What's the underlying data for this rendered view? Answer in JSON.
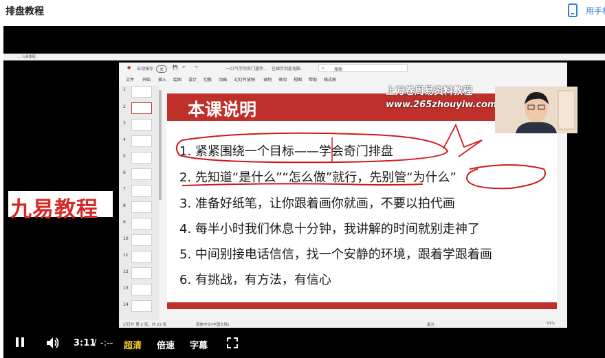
{
  "header": {
    "title": "排盘教程",
    "phone_link": "用手机"
  },
  "window_tab": {
    "text": "… 九易教程"
  },
  "ppt": {
    "autosave": "自动保存",
    "autosave_state": "关",
    "doc_name": "一口气学完奇门遁甲…",
    "save_state": "已保存到此电脑",
    "search_placeholder": "搜索",
    "menu": [
      "文件",
      "开始",
      "插入",
      "绘图",
      "设计",
      "切换",
      "动画",
      "幻灯片放映",
      "录制",
      "审阅",
      "视图",
      "帮助",
      "格式刷"
    ],
    "status_left": "幻灯片 第 2 张，共 23 张",
    "status_lang": "简体中文(中国大陆)",
    "status_notes": "备注",
    "zoom": "91%",
    "thumb_numbers": [
      "1",
      "2",
      "3",
      "4",
      "5",
      "6",
      "7",
      "8",
      "9",
      "10",
      "11",
      "12",
      "13",
      "14"
    ]
  },
  "slide": {
    "title": "本课说明",
    "lines": [
      "1. 紧紧围绕一个目标——学会奇门排盘",
      "2. 先知道“是什么”“怎么做”就行，先别管“为什么”",
      "3. 准备好纸笔，让你跟着画你就画，不要以拍代画",
      "4. 每半小时我们休息十分钟，我讲解的时间就别走神了",
      "5. 中间别接电话信信，找一个安静的环境，跟着学跟着画",
      "6. 有挑战，有方法，有信心"
    ]
  },
  "watermarks": {
    "brand": "九易教程",
    "name": "上万卷周易资料教程",
    "url": "www.265zhouyiw.com"
  },
  "player": {
    "current_time": "3:11",
    "separator": "/",
    "duration": "-:--",
    "quality": "超清",
    "speed": "倍速",
    "subtitles": "字幕"
  },
  "colors": {
    "accent_red": "#c0302b",
    "quality_yellow": "#ffcf33",
    "link_blue": "#3a7bd5"
  }
}
